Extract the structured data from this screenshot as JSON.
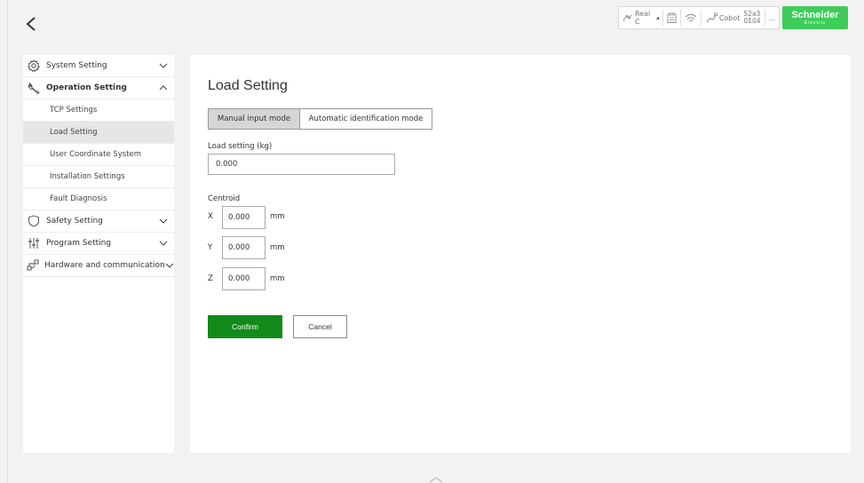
{
  "status": {
    "mode": "Real C",
    "robot": "Cobot",
    "serial_line1": "52a3",
    "serial_line2": "0104",
    "more": "..."
  },
  "brand": {
    "name": "Schneider",
    "sub": "Electric",
    "color": "#3dcd58"
  },
  "sidebar": {
    "groups": [
      {
        "label": "System Setting",
        "icon": "gear-icon",
        "expanded": false
      },
      {
        "label": "Operation Setting",
        "icon": "wrench-icon",
        "expanded": true
      },
      {
        "label": "Safety Setting",
        "icon": "shield-icon",
        "expanded": false
      },
      {
        "label": "Program Setting",
        "icon": "sliders-icon",
        "expanded": false
      },
      {
        "label": "Hardware and communication",
        "icon": "network-icon",
        "expanded": false
      }
    ],
    "operation_items": [
      {
        "label": "TCP Settings"
      },
      {
        "label": "Load Setting",
        "active": true
      },
      {
        "label": "User Coordinate System"
      },
      {
        "label": "Installation Settings"
      },
      {
        "label": "Fault Diagnosis"
      }
    ]
  },
  "main": {
    "title": "Load Setting",
    "tabs": [
      {
        "label": "Manual input mode",
        "selected": true
      },
      {
        "label": "Automatic identification mode",
        "selected": false
      }
    ],
    "load_label": "Load setting (kg)",
    "load_value": "0.000",
    "centroid_label": "Centroid",
    "centroid": [
      {
        "axis": "X",
        "value": "0.000",
        "unit": "mm"
      },
      {
        "axis": "Y",
        "value": "0.000",
        "unit": "mm"
      },
      {
        "axis": "Z",
        "value": "0.000",
        "unit": "mm"
      }
    ],
    "confirm_label": "Confirm",
    "cancel_label": "Cancel",
    "confirm_color": "#128a1c"
  }
}
